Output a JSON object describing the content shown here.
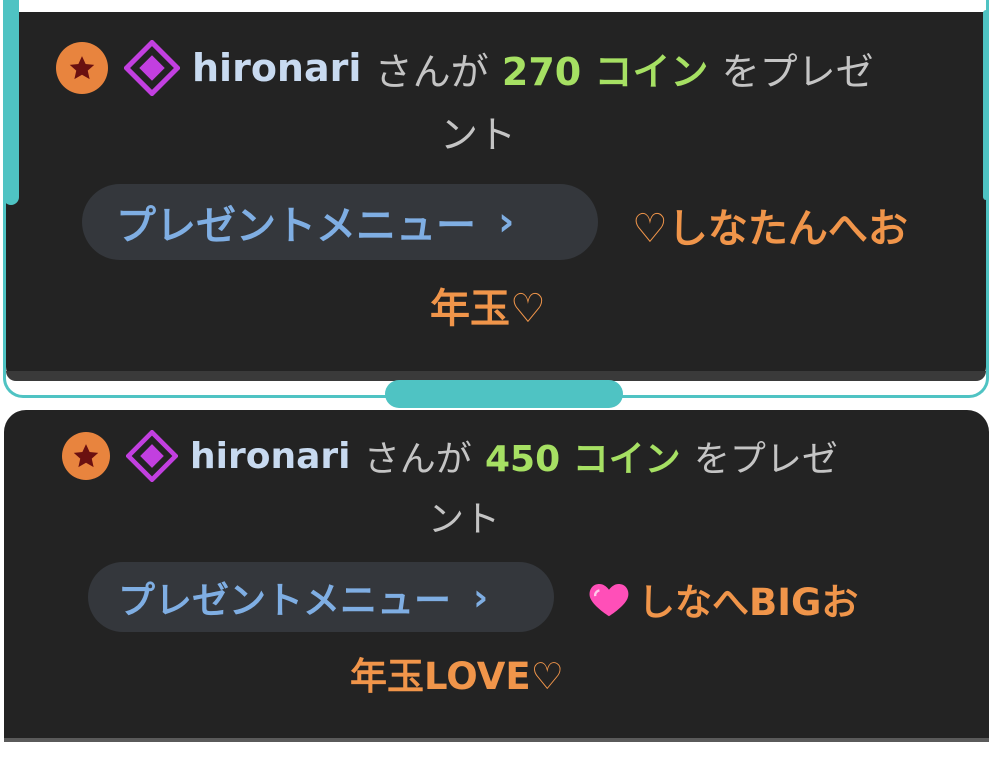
{
  "gifts": [
    {
      "username": "hironari",
      "sentence_mid": "さんが",
      "coins": "270 コイン",
      "sentence_end": "をプレゼ",
      "sentence_cont": "ント",
      "menu_label": "プレゼントメニュー",
      "menu_chevron": "›",
      "message_line1": "♡しなたんへお",
      "message_line2": "年玉♡"
    },
    {
      "username": "hironari",
      "sentence_mid": "さんが",
      "coins": "450 コイン",
      "sentence_end": "をプレゼ",
      "sentence_cont": "ント",
      "menu_label": "プレゼントメニュー",
      "menu_chevron": "›",
      "message_emoji": "heart-pink-icon",
      "message_line1": "しなへBIGお",
      "message_line2": "年玉LOVE♡"
    }
  ],
  "colors": {
    "card_bg": "#232323",
    "accent_teal": "#4fc3c3",
    "username": "#c8daf0",
    "coins": "#a6e063",
    "menu_text": "#7faee3",
    "message": "#f0954a",
    "badge_orange": "#e8843e",
    "badge_purple": "#c23fe0"
  }
}
